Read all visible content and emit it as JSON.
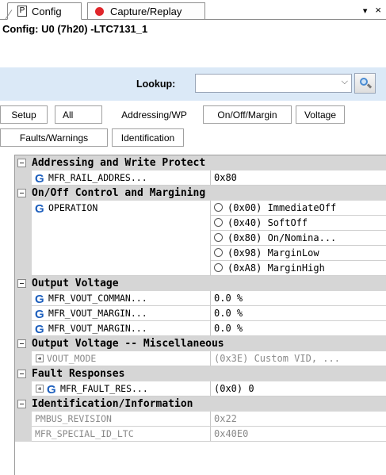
{
  "tabs": {
    "config": {
      "icon_letter": "P",
      "label": "Config"
    },
    "capture": {
      "label": "Capture/Replay"
    },
    "menu_arrow": "▾",
    "close": "×"
  },
  "config_title": "Config: U0 (7h20) -LTC7131_1",
  "lookup": {
    "label": "Lookup:",
    "value": "",
    "chevron": "⌵"
  },
  "filters": {
    "setup": "Setup",
    "all": "All",
    "addressing": "Addressing/WP",
    "onoff": "On/Off/Margin",
    "voltage": "Voltage",
    "faults": "Faults/Warnings",
    "identification": "Identification"
  },
  "grid": {
    "sec_addr": "Addressing and Write Protect",
    "mfr_rail_address": {
      "name": "MFR_RAIL_ADDRES...",
      "value": "0x80"
    },
    "sec_onoff": "On/Off Control and Margining",
    "operation": {
      "name": "OPERATION",
      "options": [
        "(0x00) ImmediateOff",
        "(0x40) SoftOff",
        "(0x80) On/Nomina...",
        "(0x98) MarginLow",
        "(0xA8) MarginHigh"
      ]
    },
    "sec_vout": "Output Voltage",
    "vout_command": {
      "name": "MFR_VOUT_COMMAN...",
      "value": "0.0 %"
    },
    "vout_margin1": {
      "name": "MFR_VOUT_MARGIN...",
      "value": "0.0 %"
    },
    "vout_margin2": {
      "name": "MFR_VOUT_MARGIN...",
      "value": "0.0 %"
    },
    "sec_vout_misc": "Output Voltage -- Miscellaneous",
    "vout_mode": {
      "name": "VOUT_MODE",
      "value": "(0x3E) Custom VID, ..."
    },
    "sec_fault": "Fault Responses",
    "fault_res": {
      "name": "MFR_FAULT_RES...",
      "value": "(0x0) 0"
    },
    "sec_ident": "Identification/Information",
    "pmbus_revision": {
      "name": "PMBUS_REVISION",
      "value": "0x22"
    },
    "special_id": {
      "name": "MFR_SPECIAL_ID_LTC",
      "value": "0x40E0"
    }
  },
  "colors": {
    "accent_blue": "#1d5fbd",
    "lookup_band": "#dbe9f7",
    "section_bg": "#d6d6d6",
    "record_red": "#e0252a"
  },
  "icons": {
    "g_icon": "G"
  }
}
